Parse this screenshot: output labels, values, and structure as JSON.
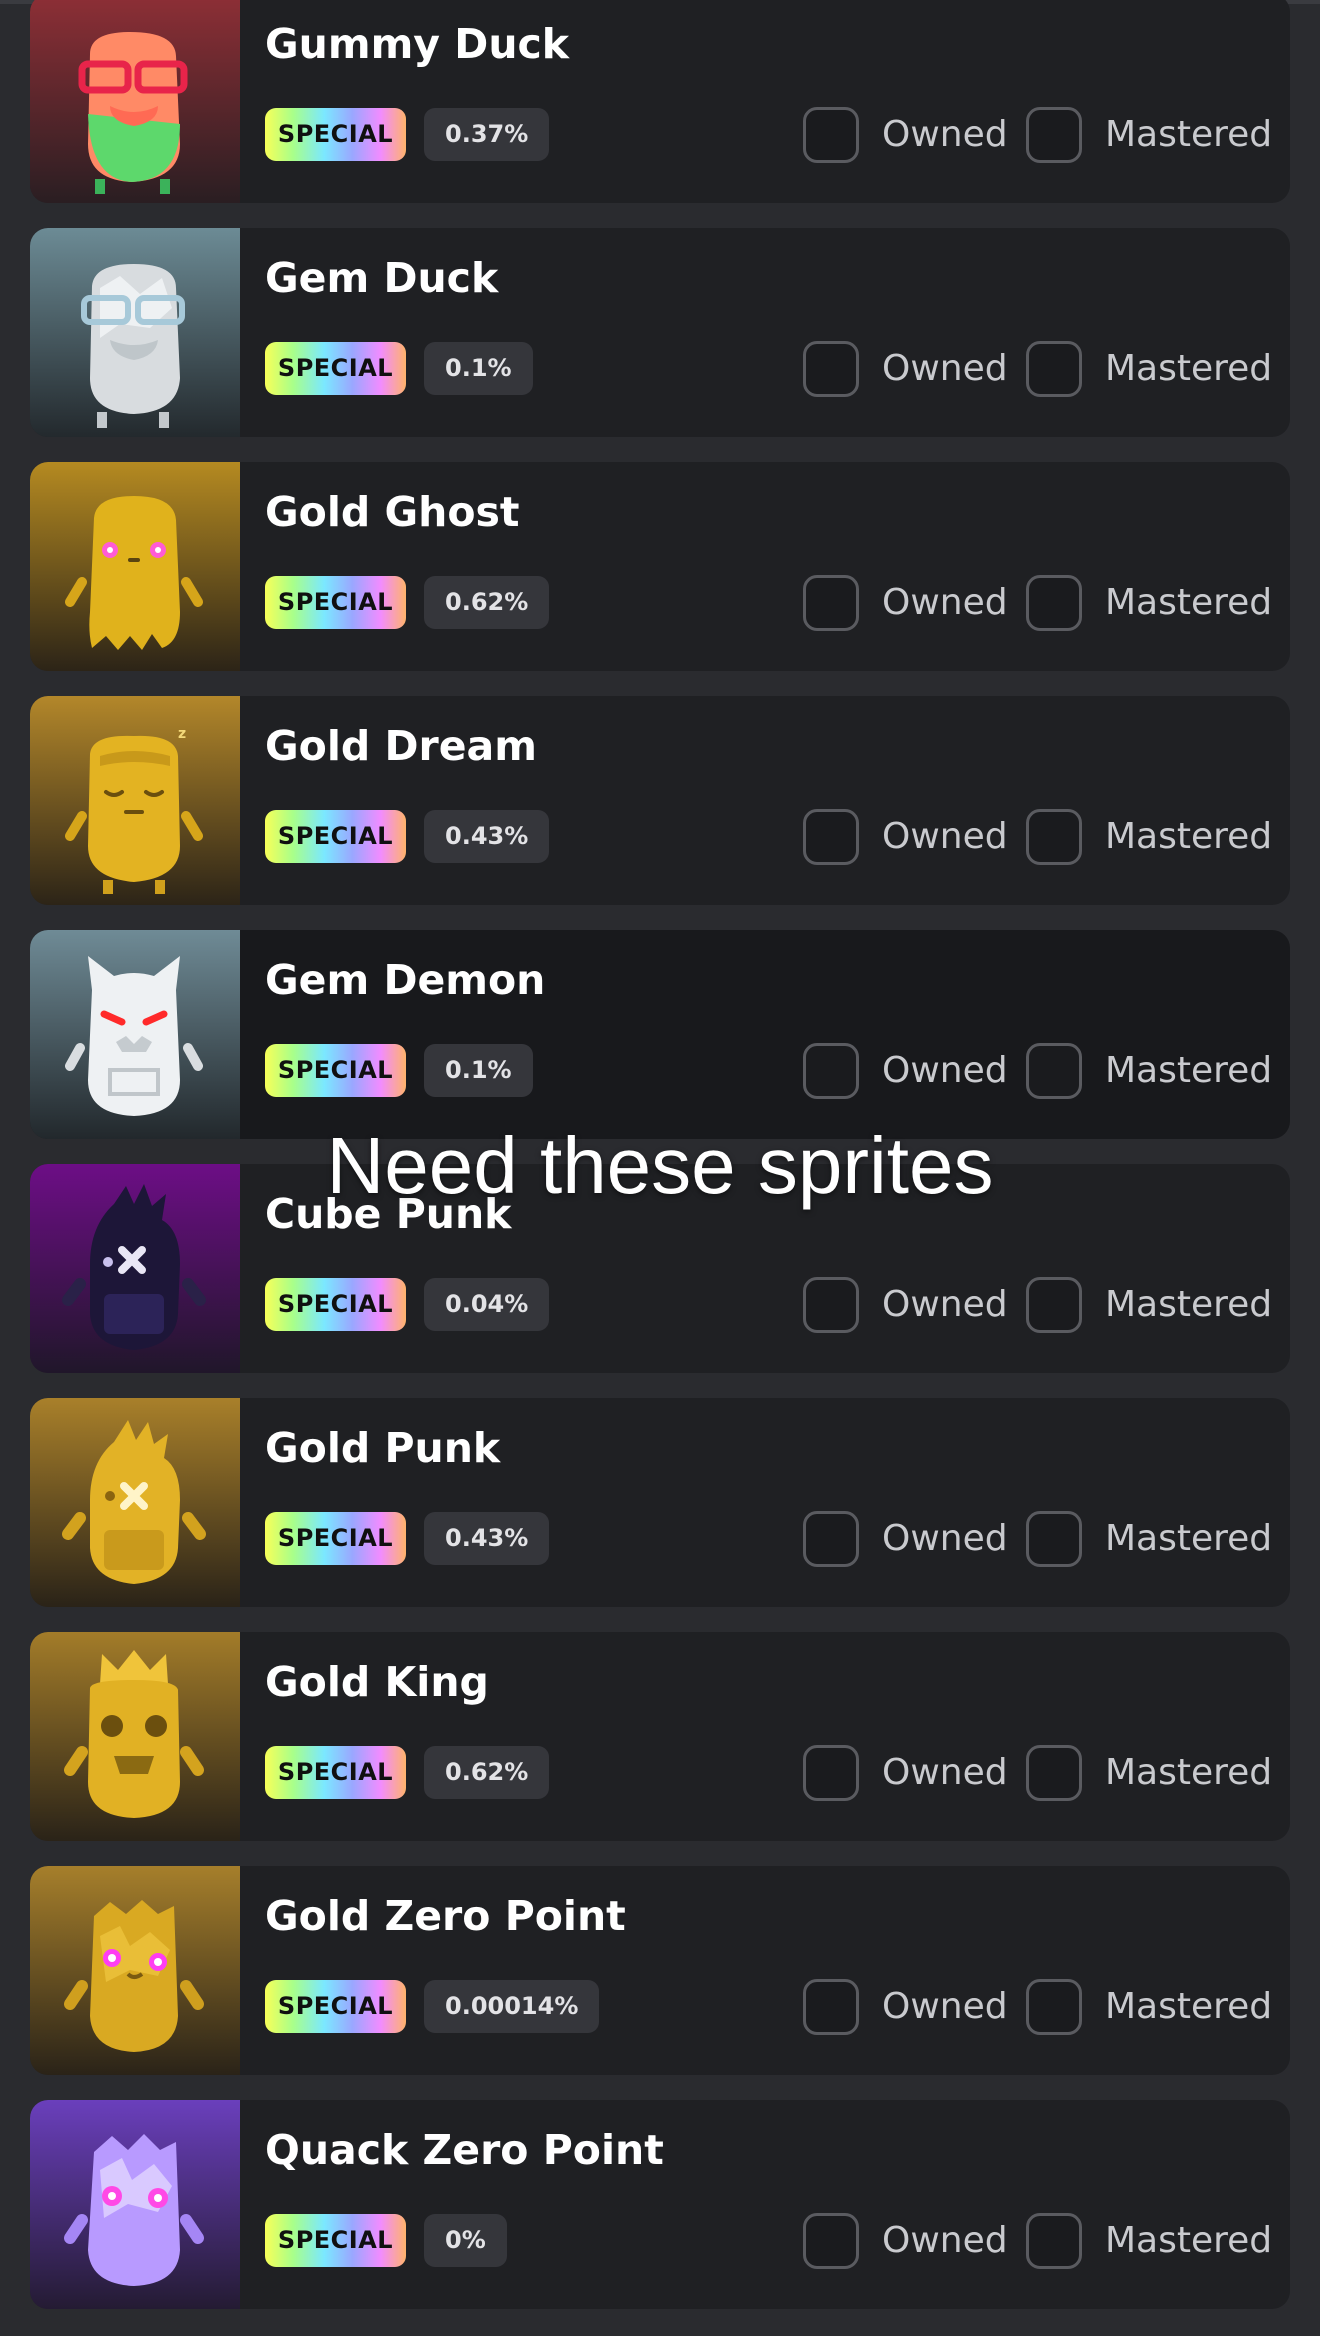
{
  "overlay_caption": "Need these sprites",
  "checkbox_labels": {
    "owned": "Owned",
    "mastered": "Mastered"
  },
  "items": [
    {
      "name": "Gummy Duck",
      "badge": "SPECIAL",
      "percent": "0.37%",
      "owned": false,
      "mastered": false,
      "bg_top": "#8e2f36",
      "bg_bottom": "#2a1e22",
      "sprite": "gummy-duck-sprite"
    },
    {
      "name": "Gem Duck",
      "badge": "SPECIAL",
      "percent": "0.1%",
      "owned": false,
      "mastered": false,
      "bg_top": "#6c8b95",
      "bg_bottom": "#23292d",
      "sprite": "gem-duck-sprite"
    },
    {
      "name": "Gold Ghost",
      "badge": "SPECIAL",
      "percent": "0.62%",
      "owned": false,
      "mastered": false,
      "bg_top": "#b58a21",
      "bg_bottom": "#2c2417",
      "sprite": "gold-ghost-sprite"
    },
    {
      "name": "Gold Dream",
      "badge": "SPECIAL",
      "percent": "0.43%",
      "owned": false,
      "mastered": false,
      "bg_top": "#b3872a",
      "bg_bottom": "#2c2417",
      "sprite": "gold-dream-sprite"
    },
    {
      "name": "Gem Demon",
      "badge": "SPECIAL",
      "percent": "0.1%",
      "owned": false,
      "mastered": false,
      "bg_top": "#6f8b96",
      "bg_bottom": "#22282c",
      "sprite": "gem-demon-sprite"
    },
    {
      "name": "Cube Punk",
      "badge": "SPECIAL",
      "percent": "0.04%",
      "owned": false,
      "mastered": false,
      "bg_top": "#6d0e86",
      "bg_bottom": "#20162a",
      "sprite": "cube-punk-sprite"
    },
    {
      "name": "Gold Punk",
      "badge": "SPECIAL",
      "percent": "0.43%",
      "owned": false,
      "mastered": false,
      "bg_top": "#a9802a",
      "bg_bottom": "#2a2318",
      "sprite": "gold-punk-sprite"
    },
    {
      "name": "Gold King",
      "badge": "SPECIAL",
      "percent": "0.62%",
      "owned": false,
      "mastered": false,
      "bg_top": "#a37c29",
      "bg_bottom": "#2a2318",
      "sprite": "gold-king-sprite"
    },
    {
      "name": "Gold Zero Point",
      "badge": "SPECIAL",
      "percent": "0.00014%",
      "owned": false,
      "mastered": false,
      "bg_top": "#a67f2b",
      "bg_bottom": "#2a2318",
      "sprite": "gold-zero-point-sprite"
    },
    {
      "name": "Quack Zero Point",
      "badge": "SPECIAL",
      "percent": "0%",
      "owned": false,
      "mastered": false,
      "bg_top": "#6a3fbc",
      "bg_bottom": "#241b33",
      "sprite": "quack-zero-point-sprite"
    }
  ]
}
